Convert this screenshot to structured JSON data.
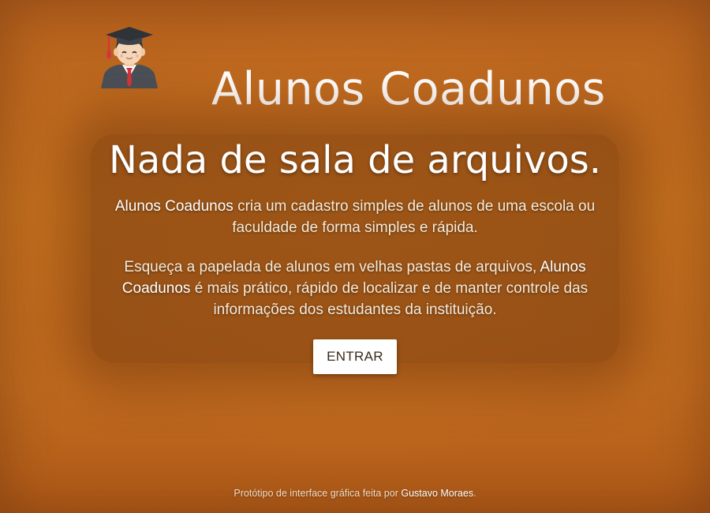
{
  "header": {
    "brand_title": "Alunos Coadunos",
    "logo_icon": "graduate-student-icon"
  },
  "hero": {
    "headline": "Nada de sala de arquivos.",
    "paragraph_1": {
      "brand": "Alunos Coadunos",
      "text": " cria um cadastro simples de alunos de uma escola ou faculdade de forma simples e rápida."
    },
    "paragraph_2": {
      "text_before": "Esqueça a papelada de alunos em velhas pastas de arquivos, ",
      "brand": "Alunos Coadunos",
      "text_after": " é mais prático, rápido de localizar e de manter controle das informações dos estudantes da instituição."
    },
    "enter_label": "ENTRAR"
  },
  "footer": {
    "text": "Protótipo de interface gráfica feita por ",
    "author": "Gustavo Moraes",
    "end": "."
  },
  "colors": {
    "background": "#c26a22",
    "hero_overlay": "#5a2808",
    "text": "#ffffff",
    "button_bg": "#ffffff",
    "button_text": "#3a2a1c"
  }
}
